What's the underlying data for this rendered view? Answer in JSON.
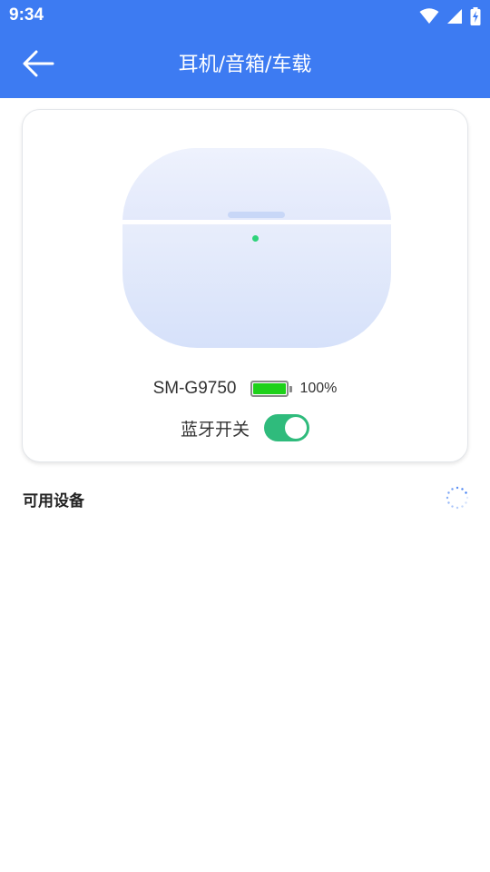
{
  "status_bar": {
    "time": "9:34",
    "icons": [
      "wifi-icon",
      "cellular-signal-icon",
      "battery-charging-icon"
    ]
  },
  "header": {
    "back_icon": "arrow-left-icon",
    "title": "耳机/音箱/车载",
    "background_color": "#3d7bf2"
  },
  "device_card": {
    "illustration": "earbuds-charging-case",
    "device_name": "SM-G9750",
    "battery": {
      "level": 1.0,
      "percent_text": "100%",
      "color": "#1ed11a"
    },
    "bluetooth": {
      "label": "蓝牙开关",
      "enabled": true,
      "toggle_color": "#2fbb7c"
    }
  },
  "available_devices": {
    "label": "可用设备",
    "loading_icon": "loading-spinner-icon",
    "items": []
  }
}
